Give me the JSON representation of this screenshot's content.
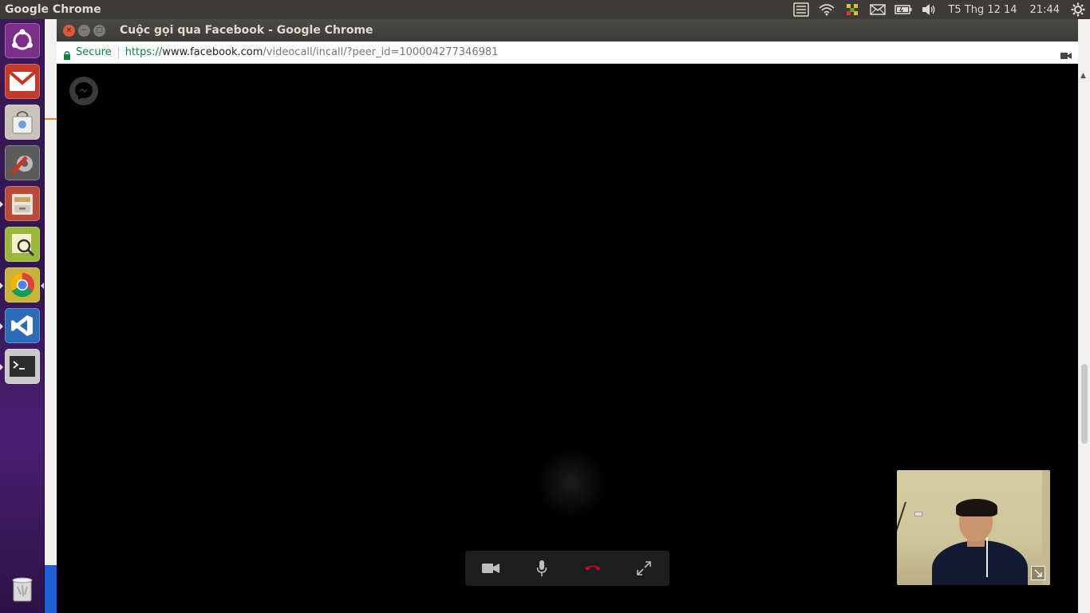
{
  "top_panel": {
    "app_name": "Google Chrome",
    "indicators": {
      "keyboard_icon": "keyboard-icon",
      "wifi_icon": "wifi-icon",
      "dropbox_icon": "dropbox-icon",
      "mail_icon": "mail-icon",
      "battery_icon": "battery-icon",
      "volume_icon": "volume-icon",
      "datetime": "T5 Thg 12 14",
      "clock": "21:44",
      "settings_icon": "gear-icon"
    }
  },
  "launcher": {
    "items": [
      {
        "name": "ubuntu-dash",
        "icon": "ubuntu-logo-icon"
      },
      {
        "name": "gmail",
        "icon": "mail-icon"
      },
      {
        "name": "software-center",
        "icon": "shopping-bag-icon"
      },
      {
        "name": "system-settings",
        "icon": "wrench-icon"
      },
      {
        "name": "files",
        "icon": "file-cabinet-icon"
      },
      {
        "name": "system-monitor",
        "icon": "magnifier-icon"
      },
      {
        "name": "google-chrome",
        "icon": "chrome-icon"
      },
      {
        "name": "vscode",
        "icon": "vscode-icon"
      },
      {
        "name": "terminal",
        "icon": "terminal-icon"
      },
      {
        "name": "trash",
        "icon": "trash-icon"
      }
    ]
  },
  "window": {
    "title": "Cuộc gọi qua Facebook - Google Chrome",
    "buttons": {
      "close": "×",
      "minimize": "−",
      "maximize": "□"
    }
  },
  "address_bar": {
    "secure_label": "Secure",
    "url_scheme": "https://",
    "url_host": "www.facebook.com",
    "url_path": "/videocall/incall/?peer_id=100004277346981"
  },
  "call": {
    "controls": [
      "camera-icon",
      "microphone-icon",
      "end-call-icon",
      "fullscreen-icon"
    ],
    "colors": {
      "end_call": "#d0021b",
      "control_bg": "#1e1e1e"
    }
  }
}
